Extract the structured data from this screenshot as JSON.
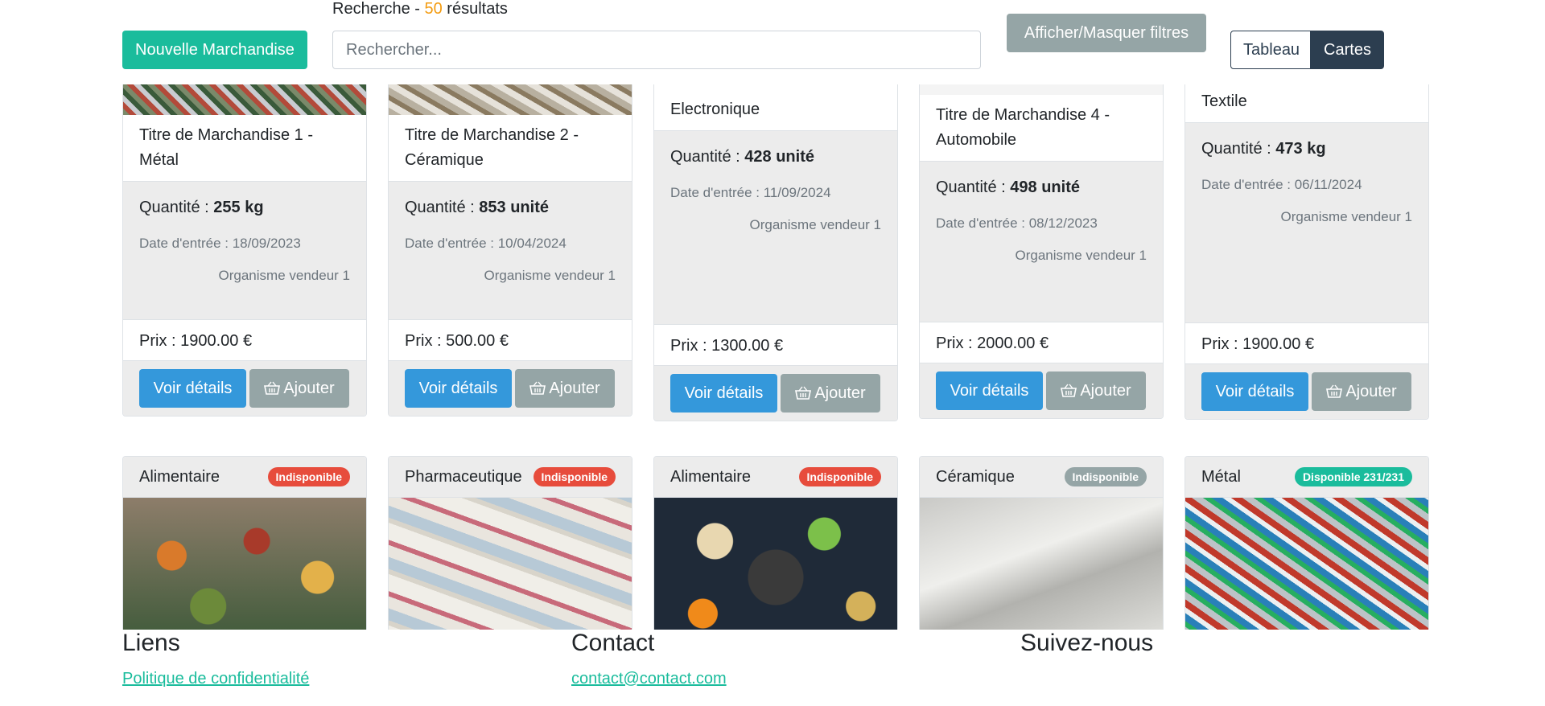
{
  "header": {
    "new_button": "Nouvelle Marchandise",
    "search_label_prefix": "Recherche - ",
    "search_count": "50",
    "search_label_suffix": " résultats",
    "search_placeholder": "Rechercher...",
    "filters_button": "Afficher/Masquer filtres",
    "view_table": "Tableau",
    "view_cards": "Cartes"
  },
  "labels": {
    "quantity": "Quantité : ",
    "date": "Date d'entrée : ",
    "price": "Prix : ",
    "details_button": "Voir détails",
    "add_button": "Ajouter"
  },
  "row1": [
    {
      "title": "Titre de Marchandise 1 - Métal",
      "quantity": "255 kg",
      "date": "18/09/2023",
      "org": "Organisme vendeur 1",
      "price": "1900.00 €"
    },
    {
      "title": "Titre de Marchandise 2 - Céramique",
      "quantity": "853 unité",
      "date": "10/04/2024",
      "org": "Organisme vendeur 1",
      "price": "500.00 €"
    },
    {
      "title": "Electronique",
      "quantity": "428 unité",
      "date": "11/09/2024",
      "org": "Organisme vendeur 1",
      "price": "1300.00 €"
    },
    {
      "title": "Titre de Marchandise 4 - Automobile",
      "quantity": "498 unité",
      "date": "08/12/2023",
      "org": "Organisme vendeur 1",
      "price": "2000.00 €"
    },
    {
      "title": "Textile",
      "quantity": "473 kg",
      "date": "06/11/2024",
      "org": "Organisme vendeur 1",
      "price": "1900.00 €"
    }
  ],
  "row2": [
    {
      "category": "Alimentaire",
      "badge": "Indisponible",
      "badge_color": "#e74c3c"
    },
    {
      "category": "Pharmaceutique",
      "badge": "Indisponible",
      "badge_color": "#e74c3c"
    },
    {
      "category": "Alimentaire",
      "badge": "Indisponible",
      "badge_color": "#e74c3c"
    },
    {
      "category": "Céramique",
      "badge": "Indisponible",
      "badge_color": "#95a5a6"
    },
    {
      "category": "Métal",
      "badge": "Disponible 231/231",
      "badge_color": "#1abc9c"
    }
  ],
  "footer": {
    "links_title": "Liens",
    "privacy_link": "Politique de confidentialité",
    "contact_title": "Contact",
    "contact_email": "contact@contact.com",
    "follow_title": "Suivez-nous"
  },
  "colors": {
    "primary": "#1abc9c",
    "info": "#3498db",
    "secondary": "#95a5a6",
    "dark": "#2c3e50",
    "danger": "#e74c3c",
    "warning": "#f39c12"
  }
}
